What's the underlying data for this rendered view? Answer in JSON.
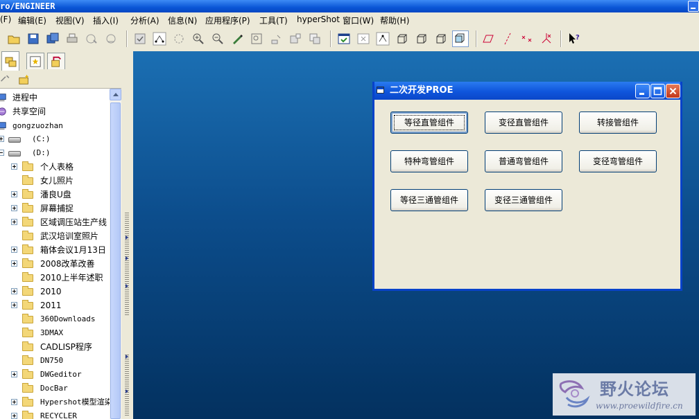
{
  "window": {
    "title": "ro/ENGINEER"
  },
  "menu": [
    "(F)",
    "编辑(E)",
    "视图(V)",
    "插入(I)",
    "分析(A)",
    "信息(N)",
    "应用程序(P)",
    "工具(T)",
    "hyperShot",
    "窗口(W)",
    "帮助(H)"
  ],
  "tree": {
    "items": [
      {
        "label": "进程中"
      },
      {
        "label": "共享空间"
      },
      {
        "label": "gongzuozhan"
      },
      {
        "label": "(C:)"
      },
      {
        "label": "(D:)"
      },
      {
        "label": "个人表格"
      },
      {
        "label": "女儿照片"
      },
      {
        "label": "潘良U盘"
      },
      {
        "label": "屏幕捕捉"
      },
      {
        "label": "区域调压站生产线"
      },
      {
        "label": "武汉培训室照片"
      },
      {
        "label": "箱体会议1月13日"
      },
      {
        "label": "2008改革改善"
      },
      {
        "label": "2010上半年述职"
      },
      {
        "label": "2010"
      },
      {
        "label": "2011"
      },
      {
        "label": "360Downloads"
      },
      {
        "label": "3DMAX"
      },
      {
        "label": "CADLISP程序"
      },
      {
        "label": "DN750"
      },
      {
        "label": "DWGeditor"
      },
      {
        "label": "DocBar"
      },
      {
        "label": "Hypershot模型渲染"
      },
      {
        "label": "RECYCLER"
      }
    ]
  },
  "dialog": {
    "title": "二次开发PROE",
    "buttons": [
      "等径直管组件",
      "变径直管组件",
      "转接管组件",
      "特种弯管组件",
      "普通弯管组件",
      "变径弯管组件",
      "等径三通管组件",
      "变径三通管组件"
    ]
  },
  "watermark": {
    "name": "野火论坛",
    "url": "www.proewildfire.cn"
  }
}
